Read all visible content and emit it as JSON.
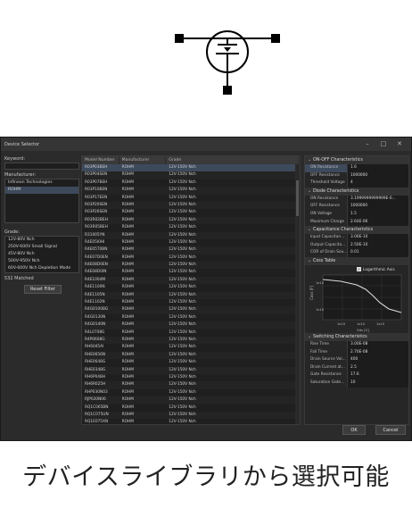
{
  "window": {
    "title": "Device Selector",
    "min": "–",
    "max": "□",
    "close": "✕"
  },
  "left": {
    "keyword_label": "Keyword:",
    "manufacturer_label": "Manufacturer:",
    "manufacturers": [
      "Infineon Technologies",
      "ROHM"
    ],
    "grade_label": "Grade:",
    "grades": [
      "12V-80V Nch",
      "250V-600V Small Signal",
      "45V-80V Nch",
      "500V-950V Nch",
      "60V-600V Nch Depletion Mode"
    ],
    "matched": "532 Matched",
    "reset_label": "Reset Filter"
  },
  "table": {
    "headers": [
      "Model Number",
      "Manufacturer",
      "Grade"
    ],
    "rows": [
      [
        "R03P03BEH",
        "ROHM",
        "12V-150V Nch"
      ],
      [
        "R03P04SEN",
        "ROHM",
        "12V-150V Nch"
      ],
      [
        "R03P07BEH",
        "ROHM",
        "12V-150V Nch"
      ],
      [
        "R03P10BEN",
        "ROHM",
        "12V-150V Nch"
      ],
      [
        "R03P17EEN",
        "ROHM",
        "12V-150V Nch"
      ],
      [
        "R03P20SEN",
        "ROHM",
        "12V-150V Nch"
      ],
      [
        "R03P26SEN",
        "ROHM",
        "12V-150V Nch"
      ],
      [
        "R03R02BEH",
        "ROHM",
        "12V-150V Nch"
      ],
      [
        "R03R05BEH",
        "ROHM",
        "12V-150V Nch"
      ],
      [
        "R31005YN",
        "ROHM",
        "12V-150V Nch"
      ],
      [
        "R4E05I0HI",
        "ROHM",
        "12V-150V Nch"
      ],
      [
        "R4E05T0BN",
        "ROHM",
        "12V-150V Nch"
      ],
      [
        "R4E07D0EN",
        "ROHM",
        "12V-150V Nch"
      ],
      [
        "R4E08D0EN",
        "ROHM",
        "12V-150V Nch"
      ],
      [
        "R4E08D0IN",
        "ROHM",
        "12V-150V Nch"
      ],
      [
        "R4E1004M",
        "ROHM",
        "12V-150V Nch"
      ],
      [
        "R4E1100N",
        "ROHM",
        "12V-150V Nch"
      ],
      [
        "R4E1105N",
        "ROHM",
        "12V-150V Nch"
      ],
      [
        "R4E1102N",
        "ROHM",
        "12V-150V Nch"
      ],
      [
        "R4G0100BG",
        "ROHM",
        "12V-150V Nch"
      ],
      [
        "R4G0130N",
        "ROHM",
        "12V-150V Nch"
      ],
      [
        "R4G0140N",
        "ROHM",
        "12V-150V Nch"
      ],
      [
        "R4L0708G",
        "ROHM",
        "12V-150V Nch"
      ],
      [
        "R4P0608G",
        "ROHM",
        "12V-150V Nch"
      ],
      [
        "RH6045AI",
        "ROHM",
        "12V-150V Nch"
      ],
      [
        "RHE0656N",
        "ROHM",
        "12V-150V Nch"
      ],
      [
        "RHE0648G",
        "ROHM",
        "12V-150V Nch"
      ],
      [
        "RHE0348G",
        "ROHM",
        "12V-150V Nch"
      ],
      [
        "RH6P048H",
        "ROHM",
        "12V-150V Nch"
      ],
      [
        "RH6R025H",
        "ROHM",
        "12V-150V Nch"
      ],
      [
        "RHP030N03",
        "ROHM",
        "12V-150V Nch"
      ],
      [
        "RJP020N06",
        "ROHM",
        "12V-150V Nch"
      ],
      [
        "RQ1C065BN",
        "ROHM",
        "12V-150V Nch"
      ],
      [
        "RQ1C075UN",
        "ROHM",
        "12V-150V Nch"
      ],
      [
        "RQ1E075XN",
        "ROHM",
        "12V-150V Nch"
      ]
    ]
  },
  "props": {
    "onoff": {
      "title": "ON-OFF Characteristics",
      "rows": [
        [
          "ON Resistance",
          "1.6"
        ],
        [
          "OFF Resistance",
          "1000000"
        ],
        [
          "Threshold Voltage",
          "4"
        ]
      ]
    },
    "diode": {
      "title": "Diode Characteristics",
      "rows": [
        [
          "ON Resistance",
          "3.1999999999999E-0..."
        ],
        [
          "OFF Resistance",
          "1000000"
        ],
        [
          "ON Voltage",
          "1.5"
        ],
        [
          "Maximum Charge",
          "2.64E-06"
        ]
      ]
    },
    "cap": {
      "title": "Capacitance Characteristics",
      "rows": [
        [
          "Input Capacitan...",
          "3.00E-10"
        ],
        [
          "Output Capacita...",
          "2.50E-10"
        ],
        [
          "COR of Drain Sou...",
          "0.01"
        ]
      ]
    },
    "coss": {
      "title": "Coss Table",
      "log_label": "Logarithmic Axis",
      "ylabel": "Coss [F]",
      "xlabel": "Vds [V]",
      "yticks": [
        "1x10",
        "1x10"
      ],
      "xticks": [
        "1x10",
        "1x10",
        "1x10"
      ]
    },
    "sw": {
      "title": "Switching Characteristics",
      "rows": [
        [
          "Rise Time",
          "3.00E-08"
        ],
        [
          "Fall Time",
          "2.70E-08"
        ],
        [
          "Drain Source Vol...",
          "400"
        ],
        [
          "Drain Current at...",
          "2.5"
        ],
        [
          "Gate Resistance",
          "17.6"
        ],
        [
          "Saturation Gate...",
          "10"
        ]
      ]
    }
  },
  "buttons": {
    "ok": "OK",
    "cancel": "Cancel"
  },
  "caption": "デバイスライブラリから選択可能"
}
